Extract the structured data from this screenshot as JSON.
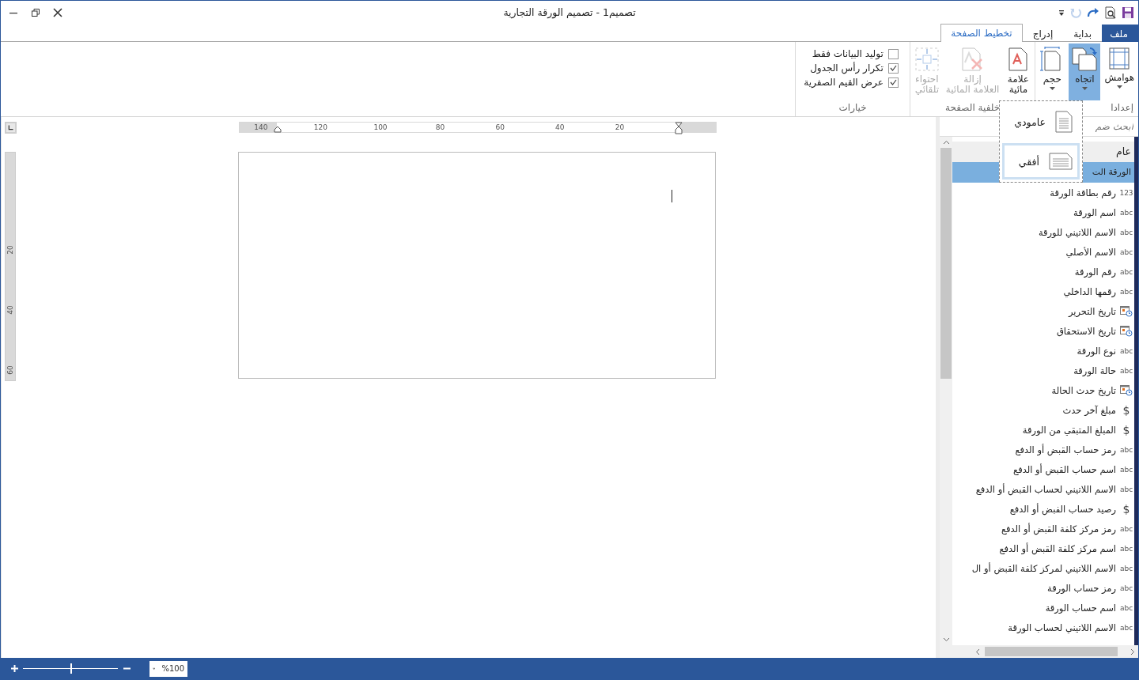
{
  "window": {
    "title": "تصميم1 - تصميم الورقة التجارية"
  },
  "quick_access": [
    {
      "kind": "save",
      "disabled": false
    },
    {
      "kind": "preview",
      "disabled": false
    },
    {
      "kind": "redo",
      "disabled": false
    },
    {
      "kind": "undo",
      "disabled": true
    },
    {
      "kind": "customize",
      "disabled": false
    }
  ],
  "tabs": [
    {
      "label": "ملف",
      "kind": "file",
      "selected": false
    },
    {
      "label": "بداية",
      "kind": "tab",
      "selected": false
    },
    {
      "label": "إدراج",
      "kind": "tab",
      "selected": false
    },
    {
      "label": "تخطيط الصفحة",
      "kind": "tab",
      "selected": true
    }
  ],
  "ribbon": {
    "groups": [
      {
        "label": "إعدادا",
        "kind": "buttons",
        "buttons": [
          {
            "lines": [
              "هوامش"
            ],
            "kind": "margins",
            "dropdown": true,
            "pressed": false,
            "disabled": false
          },
          {
            "lines": [
              "اتجاه"
            ],
            "kind": "orientation",
            "dropdown": true,
            "pressed": true,
            "disabled": false
          },
          {
            "lines": [
              "حجم"
            ],
            "kind": "size",
            "dropdown": true,
            "pressed": false,
            "disabled": false
          }
        ]
      },
      {
        "label": "خلفية الصفحة",
        "kind": "buttons",
        "buttons": [
          {
            "lines": [
              "علامة",
              "مائية"
            ],
            "kind": "watermark",
            "dropdown": false,
            "pressed": false,
            "disabled": false
          },
          {
            "lines": [
              "إزالة",
              "العلامة المائية"
            ],
            "kind": "remove-watermark",
            "dropdown": false,
            "pressed": false,
            "disabled": true
          },
          {
            "lines": [
              "احتواء",
              "تلقائي"
            ],
            "kind": "autofit",
            "dropdown": false,
            "pressed": false,
            "disabled": true
          }
        ]
      },
      {
        "label": "خيارات",
        "kind": "checks",
        "checks": [
          {
            "label": "توليد البيانات فقط",
            "checked": false
          },
          {
            "label": "تكرار رأس الجدول",
            "checked": true
          },
          {
            "label": "عرض القيم الصفرية",
            "checked": true
          }
        ]
      }
    ]
  },
  "orientation_menu": {
    "items": [
      {
        "label": "عامودي",
        "kind": "portrait",
        "selected": false
      },
      {
        "label": "أفقي",
        "kind": "landscape",
        "selected": true
      }
    ]
  },
  "ruler": {
    "labels": [
      "20",
      "40",
      "60",
      "80",
      "100",
      "120",
      "140"
    ],
    "vertical_labels": [
      "20",
      "40",
      "60"
    ]
  },
  "fields": {
    "search": {
      "placeholder": "ابحث ضم"
    },
    "header": "عام",
    "group": {
      "label": "الورقة الت",
      "selected": true
    },
    "items": [
      {
        "kind": "number",
        "badge": "123",
        "label": "رقم بطاقة الورقة"
      },
      {
        "kind": "text",
        "badge": "abc",
        "label": "اسم الورقة"
      },
      {
        "kind": "text",
        "badge": "abc",
        "label": "الاسم اللاتيني للورقة"
      },
      {
        "kind": "text",
        "badge": "abc",
        "label": "الاسم الأصلي"
      },
      {
        "kind": "text",
        "badge": "abc",
        "label": "رقم الورقة"
      },
      {
        "kind": "text",
        "badge": "abc",
        "label": "رقمها الداخلي"
      },
      {
        "kind": "date",
        "label": "تاريخ التحرير"
      },
      {
        "kind": "date",
        "label": "تاريخ الاستحقاق"
      },
      {
        "kind": "text",
        "badge": "abc",
        "label": "نوع الورقة"
      },
      {
        "kind": "text",
        "badge": "abc",
        "label": "حالة الورقة"
      },
      {
        "kind": "date",
        "label": "تاريخ حدث الحالة"
      },
      {
        "kind": "money",
        "badge": "$",
        "label": "مبلغ آخر حدث"
      },
      {
        "kind": "money",
        "badge": "$",
        "label": "المبلغ المتبقي من الورقة"
      },
      {
        "kind": "text",
        "badge": "abc",
        "label": "رمز حساب القبض أو الدفع"
      },
      {
        "kind": "text",
        "badge": "abc",
        "label": "اسم حساب القبض أو الدفع"
      },
      {
        "kind": "text",
        "badge": "abc",
        "label": "الاسم اللاتيني لحساب القبض أو الدفع"
      },
      {
        "kind": "money",
        "badge": "$",
        "label": "رصيد حساب الفبض أو الدفع"
      },
      {
        "kind": "text",
        "badge": "abc",
        "label": "رمز مركز كلفة القبض أو الدفع"
      },
      {
        "kind": "text",
        "badge": "abc",
        "label": "اسم مركز كلفة القبض أو الدفع"
      },
      {
        "kind": "text",
        "badge": "abc",
        "label": "الاسم اللاتيني لمركز كلفة القبض أو ال"
      },
      {
        "kind": "text",
        "badge": "abc",
        "label": "رمز حساب الورقة"
      },
      {
        "kind": "text",
        "badge": "abc",
        "label": "اسم حساب الورقة"
      },
      {
        "kind": "text",
        "badge": "abc",
        "label": "الاسم اللاتيني لحساب الورقة"
      }
    ]
  },
  "status_bar": {
    "zoom": {
      "level": 0.5,
      "value": "%100"
    }
  }
}
